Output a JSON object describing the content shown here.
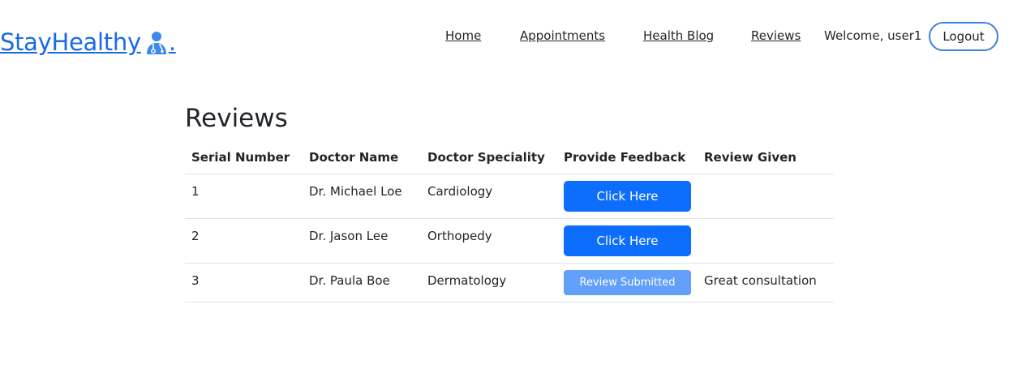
{
  "brand": {
    "name": "StayHealthy",
    "icon": "doctor-icon",
    "suffix": ".",
    "color": "#1a6ae8"
  },
  "nav": {
    "links": [
      {
        "label": "Home"
      },
      {
        "label": "Appointments"
      },
      {
        "label": "Health Blog"
      },
      {
        "label": "Reviews"
      }
    ],
    "welcome": "Welcome, user1",
    "logout_label": "Logout"
  },
  "page": {
    "title": "Reviews"
  },
  "table": {
    "headers": [
      "Serial Number",
      "Doctor Name",
      "Doctor Speciality",
      "Provide Feedback",
      "Review Given"
    ],
    "rows": [
      {
        "serial": "1",
        "doctor": "Dr. Michael Loe",
        "speciality": "Cardiology",
        "feedback_label": "Click Here",
        "review": ""
      },
      {
        "serial": "2",
        "doctor": "Dr. Jason Lee",
        "speciality": "Orthopedy",
        "feedback_label": "Click Here",
        "review": ""
      },
      {
        "serial": "3",
        "doctor": "Dr. Paula Boe",
        "speciality": "Dermatology",
        "feedback_label": "Review Submitted",
        "review": "Great consultation"
      }
    ]
  },
  "colors": {
    "primary": "#0d6efd",
    "primary_disabled": "#62a0f9",
    "logout_border": "#3b82e0"
  }
}
